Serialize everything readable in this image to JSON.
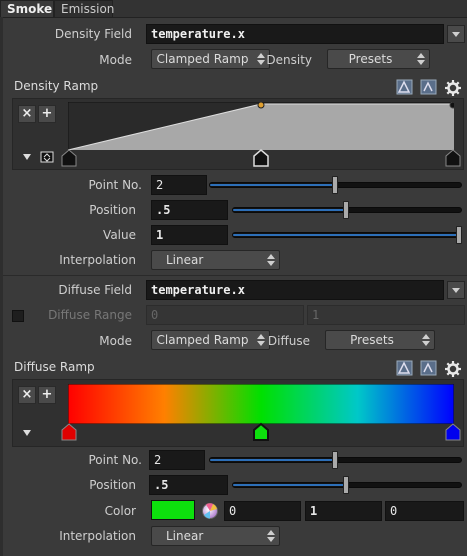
{
  "tabs": [
    {
      "label": "Smoke"
    },
    {
      "label": "Emission"
    }
  ],
  "density": {
    "field_label": "Density Field",
    "field_value": "temperature.x",
    "mode_label": "Mode",
    "mode_value": "Clamped Ramp",
    "presets_label": "Density",
    "presets_value": "Presets",
    "ramp_label": "Density Ramp",
    "point_no_label": "Point No.",
    "point_no": "2",
    "position_label": "Position",
    "position": ".5",
    "value_label": "Value",
    "value": "1",
    "interp_label": "Interpolation",
    "interp_value": "Linear"
  },
  "diffuse": {
    "field_label": "Diffuse Field",
    "field_value": "temperature.x",
    "range_label": "Diffuse Range",
    "range_min": "0",
    "range_max": "1",
    "mode_label": "Mode",
    "mode_value": "Clamped Ramp",
    "presets_label": "Diffuse",
    "presets_value": "Presets",
    "ramp_label": "Diffuse Ramp",
    "point_no_label": "Point No.",
    "point_no": "2",
    "position_label": "Position",
    "position": ".5",
    "color_label": "Color",
    "color_r": "0",
    "color_g": "1",
    "color_b": "0",
    "interp_label": "Interpolation",
    "interp_value": "Linear"
  },
  "ramp_buttons": {
    "remove": "×",
    "add": "+"
  },
  "icons": {
    "ramp_icon": "lookup-icon",
    "load_icon": "preset-icon",
    "gear": "gear-icon"
  },
  "colors": {
    "accent_blue": "#2d6fb8",
    "ramp_green": "#0de00d",
    "selected_key": "#e0a030"
  }
}
